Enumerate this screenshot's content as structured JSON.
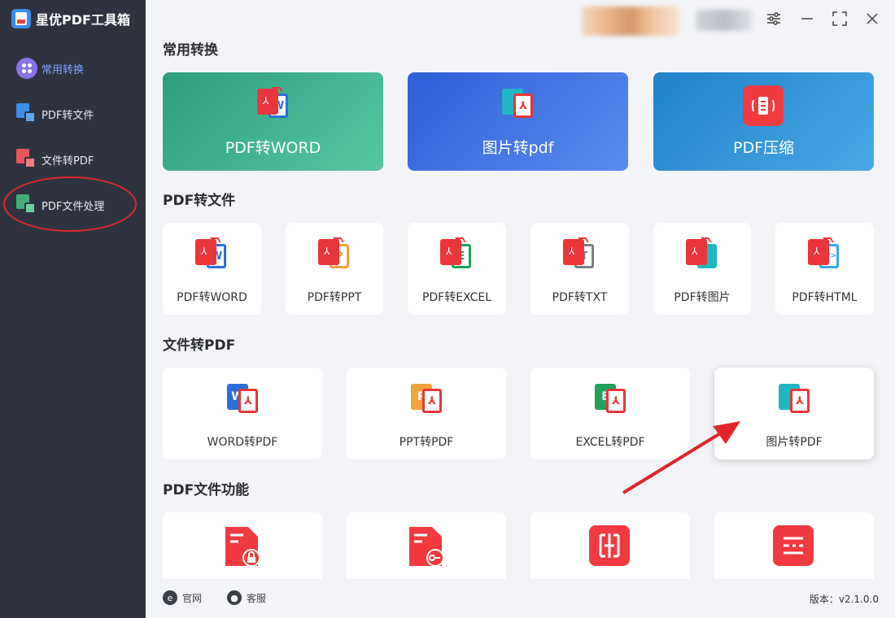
{
  "app": {
    "name": "星优PDF工具箱"
  },
  "sidebar": {
    "items": [
      {
        "label": "常用转换",
        "active": true
      },
      {
        "label": "PDF转文件"
      },
      {
        "label": "文件转PDF"
      },
      {
        "label": "PDF文件处理"
      }
    ]
  },
  "sections": {
    "common": {
      "title": "常用转换",
      "cards": [
        {
          "label": "PDF转WORD",
          "color": "#37a98a"
        },
        {
          "label": "图片转pdf",
          "color": "#3d74e6"
        },
        {
          "label": "PDF压缩",
          "color": "#2f8fd6"
        }
      ]
    },
    "pdf_to_file": {
      "title": "PDF转文件",
      "cards": [
        {
          "label": "PDF转WORD",
          "letter": "W",
          "color": "#2b6fd9"
        },
        {
          "label": "PDF转PPT",
          "letter": "P",
          "color": "#f2a23a"
        },
        {
          "label": "PDF转EXCEL",
          "letter": "E",
          "color": "#21a05a"
        },
        {
          "label": "PDF转TXT",
          "letter": "T",
          "color": "#7a7f88"
        },
        {
          "label": "PDF转图片",
          "letter": "",
          "color": "#1fb7c2"
        },
        {
          "label": "PDF转HTML",
          "letter": "</>",
          "color": "#3da2e8"
        }
      ]
    },
    "file_to_pdf": {
      "title": "文件转PDF",
      "cards": [
        {
          "label": "WORD转PDF",
          "letter": "W",
          "color": "#2b6fd9"
        },
        {
          "label": "PPT转PDF",
          "letter": "P",
          "color": "#f2a23a"
        },
        {
          "label": "EXCEL转PDF",
          "letter": "E",
          "color": "#21a05a"
        },
        {
          "label": "图片转PDF",
          "letter": "",
          "color": "#1fb7c2"
        }
      ]
    },
    "pdf_functions": {
      "title": "PDF文件功能"
    }
  },
  "footer": {
    "website": "官网",
    "support": "客服",
    "version": "版本：v2.1.0.0"
  },
  "icons": [
    "settings-icon",
    "minimize-icon",
    "maximize-icon",
    "close-icon"
  ]
}
